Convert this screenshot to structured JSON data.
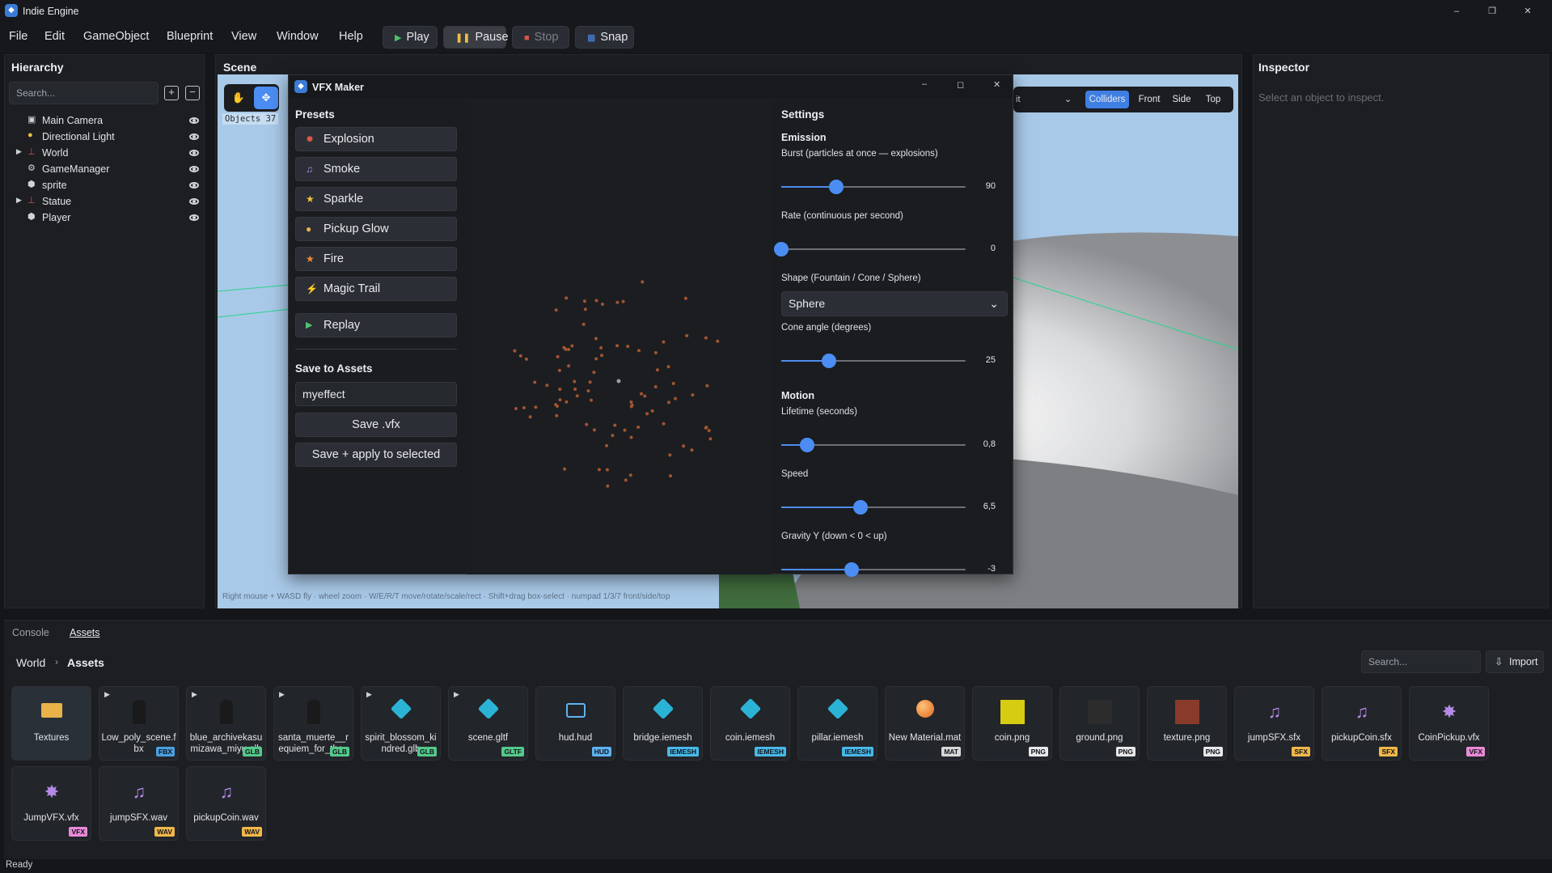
{
  "app": {
    "title": "Indie Engine",
    "status": "Ready"
  },
  "menu": [
    "File",
    "Edit",
    "GameObject",
    "Blueprint",
    "View",
    "Window",
    "Help"
  ],
  "toolbar": {
    "play": "Play",
    "pause": "Pause",
    "stop": "Stop",
    "snap": "Snap"
  },
  "hierarchy": {
    "title": "Hierarchy",
    "search_placeholder": "Search...",
    "items": [
      {
        "label": "Main Camera",
        "icon": "camera-icon",
        "expandable": false
      },
      {
        "label": "Directional Light",
        "icon": "light-bulb-icon",
        "expandable": false
      },
      {
        "label": "World",
        "icon": "axes-icon",
        "expandable": true
      },
      {
        "label": "GameManager",
        "icon": "gear-icon",
        "expandable": false
      },
      {
        "label": "sprite",
        "icon": "cube-icon",
        "expandable": false
      },
      {
        "label": "Statue",
        "icon": "axes-icon",
        "expandable": true
      },
      {
        "label": "Player",
        "icon": "cube-icon",
        "expandable": false
      }
    ]
  },
  "scene": {
    "title": "Scene",
    "objects_label": "Objects 37",
    "view_buttons": [
      "Colliders",
      "Front",
      "Side",
      "Top"
    ],
    "hint": "Right mouse + WASD fly · wheel zoom · W/E/R/T move/rotate/scale/rect · Shift+drag box-select · numpad 1/3/7 front/side/top"
  },
  "inspector": {
    "title": "Inspector",
    "empty_text": "Select an object to inspect."
  },
  "vfx": {
    "title": "VFX Maker",
    "presets_title": "Presets",
    "presets": [
      {
        "label": "Explosion",
        "icon": "burst-icon",
        "color": "#e05a4a"
      },
      {
        "label": "Smoke",
        "icon": "music-note-icon",
        "color": "#b58ae6"
      },
      {
        "label": "Sparkle",
        "icon": "star-icon",
        "color": "#f0c040"
      },
      {
        "label": "Pickup Glow",
        "icon": "coin-icon",
        "color": "#e7b14a"
      },
      {
        "label": "Fire",
        "icon": "flame-star-icon",
        "color": "#f08a3a"
      },
      {
        "label": "Magic Trail",
        "icon": "lightning-icon",
        "color": "#5fb8f0"
      }
    ],
    "replay": "Replay",
    "save_title": "Save to Assets",
    "save_name": "myeffect",
    "save_vfx": "Save .vfx",
    "save_apply": "Save + apply to selected",
    "settings_title": "Settings",
    "emission_title": "Emission",
    "burst_label": "Burst (particles at once — explosions)",
    "burst_value": "90",
    "burst_fraction": 0.3,
    "rate_label": "Rate (continuous per second)",
    "rate_value": "0",
    "rate_fraction": 0.0,
    "shape_label": "Shape (Fountain / Cone / Sphere)",
    "shape_value": "Sphere",
    "cone_label": "Cone angle (degrees)",
    "cone_value": "25",
    "cone_fraction": 0.26,
    "motion_title": "Motion",
    "lifetime_label": "Lifetime (seconds)",
    "lifetime_value": "0,8",
    "lifetime_fraction": 0.14,
    "speed_label": "Speed",
    "speed_value": "6,5",
    "speed_fraction": 0.43,
    "gravity_label": "Gravity Y (down < 0 < up)",
    "gravity_value": "-3",
    "gravity_fraction": 0.38,
    "particle_color": "#a0552f"
  },
  "bottom": {
    "tabs": [
      "Console",
      "Assets"
    ],
    "breadcrumb": [
      "World",
      "Assets"
    ],
    "search_placeholder": "Search...",
    "import": "Import",
    "assets": [
      {
        "label": "Textures",
        "badge": "",
        "type": "folder",
        "expandable": false
      },
      {
        "label": "Low_poly_scene.fbx",
        "badge": "FBX",
        "type": "model",
        "expandable": true
      },
      {
        "label": "blue_archivekasumizawa_miyu.glb",
        "badge": "GLB",
        "type": "model",
        "expandable": true
      },
      {
        "label": "santa_muerte__requiem_for_the_",
        "badge": "GLB",
        "type": "model",
        "expandable": true
      },
      {
        "label": "spirit_blossom_kindred.glb",
        "badge": "GLB",
        "type": "mesh",
        "expandable": true
      },
      {
        "label": "scene.gltf",
        "badge": "GLTF",
        "type": "mesh",
        "expandable": true
      },
      {
        "label": "hud.hud",
        "badge": "HUD",
        "type": "hud",
        "expandable": false
      },
      {
        "label": "bridge.iemesh",
        "badge": "IEMESH",
        "type": "mesh",
        "expandable": false
      },
      {
        "label": "coin.iemesh",
        "badge": "IEMESH",
        "type": "mesh",
        "expandable": false
      },
      {
        "label": "pillar.iemesh",
        "badge": "IEMESH",
        "type": "mesh",
        "expandable": false
      },
      {
        "label": "New Material.mat",
        "badge": "MAT",
        "type": "material",
        "expandable": false
      },
      {
        "label": "coin.png",
        "badge": "PNG",
        "type": "png-yellow",
        "expandable": false
      },
      {
        "label": "ground.png",
        "badge": "PNG",
        "type": "png-dark",
        "expandable": false
      },
      {
        "label": "texture.png",
        "badge": "PNG",
        "type": "png-red",
        "expandable": false
      },
      {
        "label": "jumpSFX.sfx",
        "badge": "SFX",
        "type": "sound",
        "expandable": false
      },
      {
        "label": "pickupCoin.sfx",
        "badge": "SFX",
        "type": "sound",
        "expandable": false
      },
      {
        "label": "CoinPickup.vfx",
        "badge": "VFX",
        "type": "vfx",
        "expandable": false
      },
      {
        "label": "JumpVFX.vfx",
        "badge": "VFX",
        "type": "vfx",
        "expandable": false
      },
      {
        "label": "jumpSFX.wav",
        "badge": "WAV",
        "type": "sound",
        "expandable": false
      },
      {
        "label": "pickupCoin.wav",
        "badge": "WAV",
        "type": "sound",
        "expandable": false
      }
    ]
  },
  "colors": {
    "accent": "#4b8df2",
    "badge_fbx": "#4a9fe0",
    "badge_glb": "#54c98a",
    "badge_gltf": "#54c98a",
    "badge_hud": "#5fb2f0",
    "badge_iemesh": "#48b8e8",
    "badge_mat": "#d8d8d8",
    "badge_png": "#e8e8e8",
    "badge_sfx": "#f0b84a",
    "badge_vfx": "#e98ad6",
    "badge_wav": "#f0b84a"
  }
}
